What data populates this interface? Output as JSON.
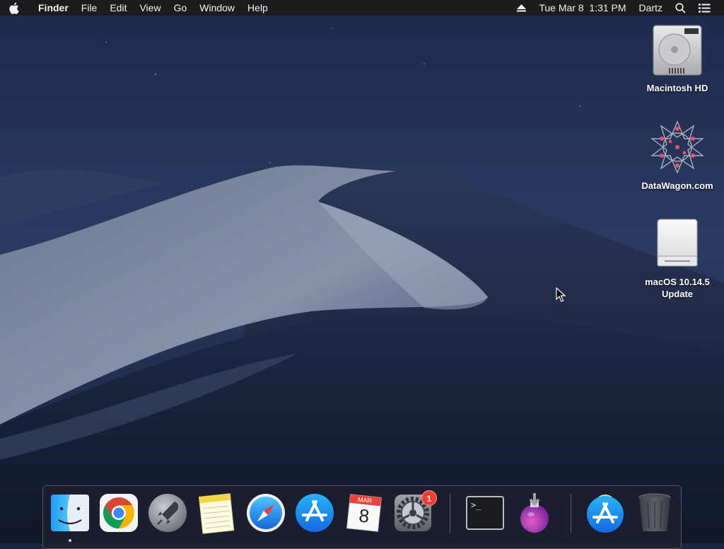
{
  "menubar": {
    "app_name": "Finder",
    "menus": [
      "File",
      "Edit",
      "View",
      "Go",
      "Window",
      "Help"
    ],
    "datetime": "Tue Mar 8  1:31 PM",
    "user": "Dartz"
  },
  "desktop": {
    "icons": [
      {
        "label": "Macintosh HD",
        "icon": "hard-drive-icon"
      },
      {
        "label": "DataWagon.com",
        "icon": "datawagon-logo-icon"
      },
      {
        "label": "macOS 10.14.5 Update",
        "icon": "external-drive-icon"
      }
    ]
  },
  "dock": {
    "apps": [
      {
        "name": "Finder",
        "icon": "finder-icon",
        "running": true
      },
      {
        "name": "Google Chrome",
        "icon": "chrome-icon"
      },
      {
        "name": "Launchpad",
        "icon": "launchpad-rocket-icon"
      },
      {
        "name": "Notes",
        "icon": "notes-icon"
      },
      {
        "name": "Safari",
        "icon": "safari-compass-icon"
      },
      {
        "name": "App Store",
        "icon": "app-store-icon"
      },
      {
        "name": "Calendar",
        "icon": "calendar-icon",
        "month": "MAR",
        "day": "8"
      },
      {
        "name": "System Preferences",
        "icon": "system-preferences-gear-icon",
        "badge": "1"
      },
      {
        "name": "Terminal",
        "icon": "terminal-icon",
        "prompt": ">_"
      },
      {
        "name": "Installer",
        "icon": "installer-flask-icon"
      },
      {
        "name": "App Store Downloads",
        "icon": "app-store-folder-icon"
      },
      {
        "name": "Trash",
        "icon": "trash-icon"
      }
    ]
  },
  "colors": {
    "menubar_bg": "#1c1c1e",
    "sky_top": "#1f2b4d",
    "badge_red": "#ff3b30",
    "accent_blue": "#1e8cf0"
  }
}
